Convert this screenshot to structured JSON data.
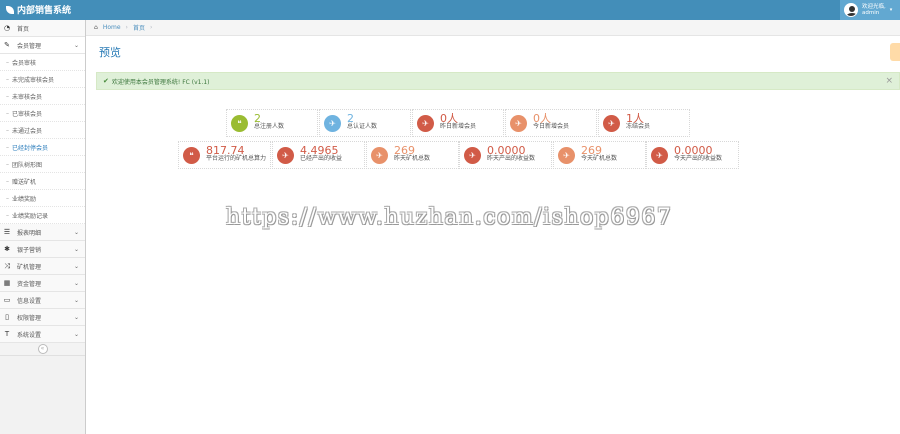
{
  "app": {
    "title": "内部销售系统"
  },
  "user": {
    "line1": "欢迎光临,",
    "line2": "admin"
  },
  "breadcrumb": {
    "home": "Home",
    "current": "首页"
  },
  "page": {
    "title": "预览"
  },
  "alert": {
    "text": "欢迎使用本会员管理系统! FC (v1.1)"
  },
  "sidebar": {
    "items": [
      {
        "label": "首页",
        "icon": "tachometer-icon"
      },
      {
        "label": "会员管理",
        "icon": "edit-icon",
        "expanded": true
      }
    ],
    "subitems": [
      {
        "label": "会员审核"
      },
      {
        "label": "未完成审核会员"
      },
      {
        "label": "未审核会员"
      },
      {
        "label": "已审核会员"
      },
      {
        "label": "未通过会员"
      },
      {
        "label": "已经封停会员"
      },
      {
        "label": "团队树形图"
      },
      {
        "label": "赠送矿机"
      },
      {
        "label": "业绩奖励"
      },
      {
        "label": "业绩奖励记录"
      }
    ],
    "groups": [
      {
        "label": "报表明细",
        "icon": "list-icon"
      },
      {
        "label": "银子营销",
        "icon": "asterisk-icon"
      },
      {
        "label": "矿机管理",
        "icon": "random-icon"
      },
      {
        "label": "资金管理",
        "icon": "calendar-icon"
      },
      {
        "label": "信息设置",
        "icon": "credit-card-icon"
      },
      {
        "label": "权限管理",
        "icon": "file-icon"
      },
      {
        "label": "系统设置",
        "icon": "text-width-icon"
      }
    ]
  },
  "stats_row1": [
    {
      "value": "2",
      "label": "总注册人数",
      "color": "#9abc32",
      "num_color": "#9abc32",
      "icon": "comments-icon"
    },
    {
      "value": "2",
      "label": "总认证人数",
      "color": "#6fb3e0",
      "num_color": "#6fb3e0",
      "icon": "twitter-icon"
    },
    {
      "value": "0人",
      "label": "昨日新增会员",
      "color": "#d15b47",
      "num_color": "#d15b47",
      "icon": "twitter-icon"
    },
    {
      "value": "0人",
      "label": "今日新增会员",
      "color": "#e8916a",
      "num_color": "#e8916a",
      "icon": "twitter-icon"
    },
    {
      "value": "1人",
      "label": "冻结会员",
      "color": "#d15b47",
      "num_color": "#d15b47",
      "icon": "twitter-icon"
    }
  ],
  "stats_row2": [
    {
      "value": "817.74",
      "label": "平台运行的矿机总算力",
      "color": "#d15b47",
      "num_color": "#d15b47",
      "icon": "comments-icon"
    },
    {
      "value": "4.4965",
      "label": "已经产出的收益",
      "color": "#d15b47",
      "num_color": "#d15b47",
      "icon": "twitter-icon"
    },
    {
      "value": "269",
      "label": "昨天矿机总数",
      "color": "#e8916a",
      "num_color": "#e8916a",
      "icon": "twitter-icon"
    },
    {
      "value": "0.0000",
      "label": "昨天产出的收益数",
      "color": "#d15b47",
      "num_color": "#d15b47",
      "icon": "twitter-icon"
    },
    {
      "value": "269",
      "label": "今天矿机总数",
      "color": "#e8916a",
      "num_color": "#e8916a",
      "icon": "twitter-icon"
    },
    {
      "value": "0.0000",
      "label": "今天产出的收益数",
      "color": "#d15b47",
      "num_color": "#d15b47",
      "icon": "twitter-icon"
    }
  ],
  "watermark": {
    "text": "https://www.huzhan.com/ishop6967"
  }
}
